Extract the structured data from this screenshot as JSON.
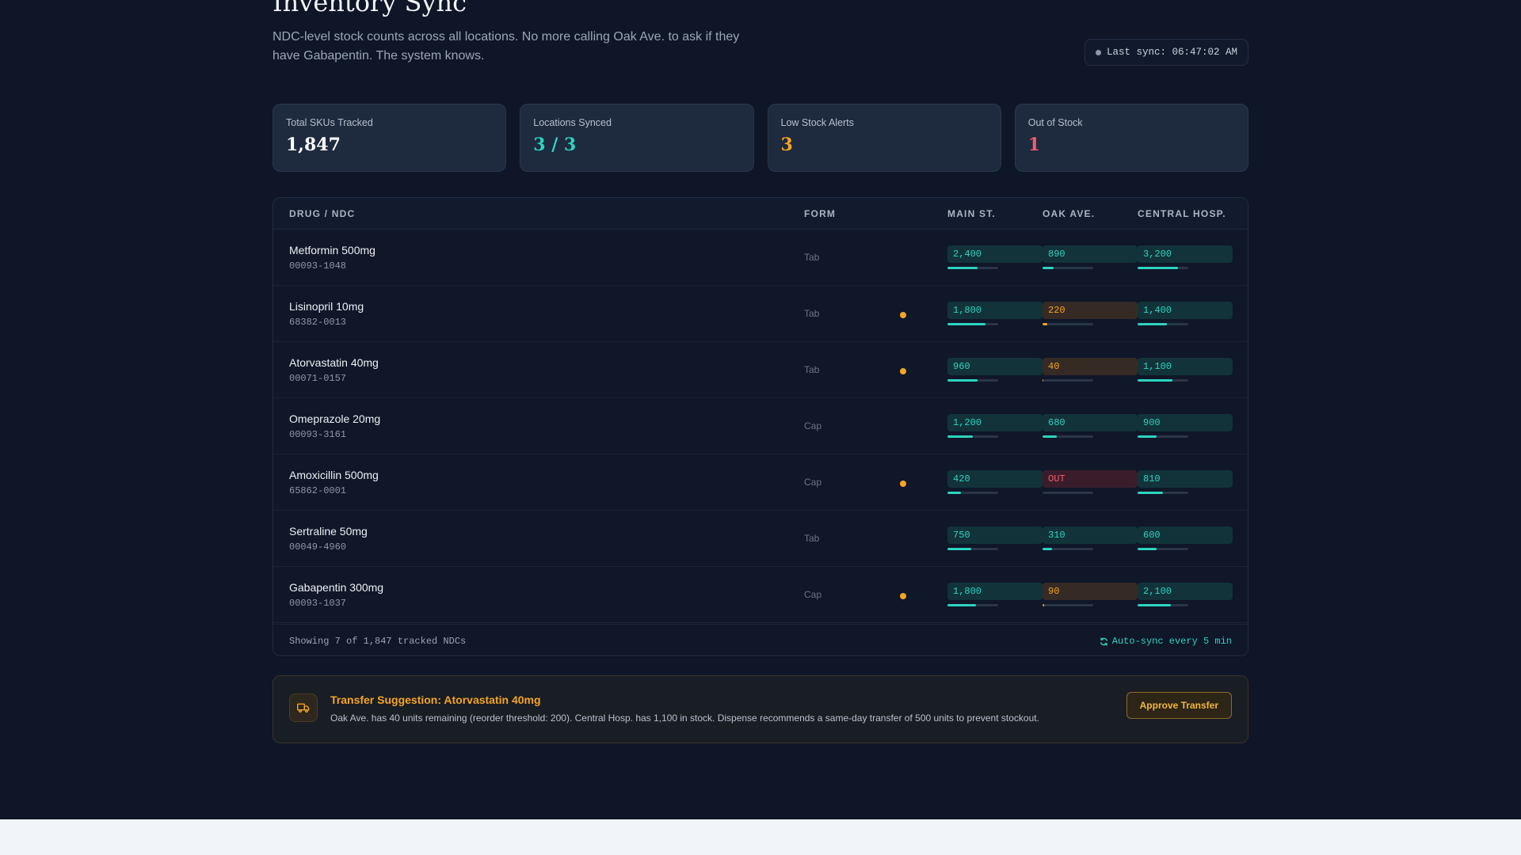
{
  "header": {
    "title": "Inventory Sync",
    "subtitle": "NDC-level stock counts across all locations. No more calling Oak Ave. to ask if they have Gabapentin. The system knows.",
    "last_sync": "Last sync: 06:47:02 AM"
  },
  "stats": [
    {
      "label": "Total SKUs Tracked",
      "value": "1,847",
      "color": "#ffffff"
    },
    {
      "label": "Locations Synced",
      "value": "3 / 3",
      "color": "#2dd4bf"
    },
    {
      "label": "Low Stock Alerts",
      "value": "3",
      "color": "#f5a524"
    },
    {
      "label": "Out of Stock",
      "value": "1",
      "color": "#f05d6c"
    }
  ],
  "table": {
    "columns": [
      "DRUG / NDC",
      "FORM",
      "MAIN ST.",
      "OAK AVE.",
      "CENTRAL HOSP."
    ],
    "rows": [
      {
        "drug": "Metformin 500mg",
        "ndc": "00093-1048",
        "form": "Tab",
        "alert": false,
        "stock": [
          {
            "text": "2,400",
            "status": "ok",
            "level": 0.6
          },
          {
            "text": "890",
            "status": "ok",
            "level": 0.22
          },
          {
            "text": "3,200",
            "status": "ok",
            "level": 0.8
          }
        ]
      },
      {
        "drug": "Lisinopril 10mg",
        "ndc": "68382-0013",
        "form": "Tab",
        "alert": true,
        "stock": [
          {
            "text": "1,800",
            "status": "ok",
            "level": 0.75
          },
          {
            "text": "220",
            "status": "low",
            "level": 0.09
          },
          {
            "text": "1,400",
            "status": "ok",
            "level": 0.58
          }
        ]
      },
      {
        "drug": "Atorvastatin 40mg",
        "ndc": "00071-0157",
        "form": "Tab",
        "alert": true,
        "stock": [
          {
            "text": "960",
            "status": "ok",
            "level": 0.6
          },
          {
            "text": "40",
            "status": "low",
            "level": 0.02
          },
          {
            "text": "1,100",
            "status": "ok",
            "level": 0.69
          }
        ]
      },
      {
        "drug": "Omeprazole 20mg",
        "ndc": "00093-3161",
        "form": "Cap",
        "alert": false,
        "stock": [
          {
            "text": "1,200",
            "status": "ok",
            "level": 0.5
          },
          {
            "text": "680",
            "status": "ok",
            "level": 0.28
          },
          {
            "text": "900",
            "status": "ok",
            "level": 0.37
          }
        ]
      },
      {
        "drug": "Amoxicillin 500mg",
        "ndc": "65862-0001",
        "form": "Cap",
        "alert": true,
        "stock": [
          {
            "text": "420",
            "status": "ok",
            "level": 0.26
          },
          {
            "text": "OUT",
            "status": "out",
            "level": 0
          },
          {
            "text": "810",
            "status": "ok",
            "level": 0.5
          }
        ]
      },
      {
        "drug": "Sertraline 50mg",
        "ndc": "00049-4960",
        "form": "Tab",
        "alert": false,
        "stock": [
          {
            "text": "750",
            "status": "ok",
            "level": 0.47
          },
          {
            "text": "310",
            "status": "ok",
            "level": 0.19
          },
          {
            "text": "600",
            "status": "ok",
            "level": 0.37
          }
        ]
      },
      {
        "drug": "Gabapentin 300mg",
        "ndc": "00093-1037",
        "form": "Cap",
        "alert": true,
        "stock": [
          {
            "text": "1,800",
            "status": "ok",
            "level": 0.56
          },
          {
            "text": "90",
            "status": "low",
            "level": 0.03
          },
          {
            "text": "2,100",
            "status": "ok",
            "level": 0.66
          }
        ]
      }
    ],
    "footer_left": "Showing 7 of 1,847 tracked NDCs",
    "footer_right": "Auto-sync every 5 min"
  },
  "transfer": {
    "title": "Transfer Suggestion: Atorvastatin 40mg",
    "body": "Oak Ave. has 40 units remaining (reorder threshold: 200). Central Hosp. has 1,100 in stock. Dispense recommends a same-day transfer of 500 units to prevent stockout.",
    "button": "Approve Transfer",
    "icon": "truck-icon"
  },
  "colors": {
    "background": "#0e1628",
    "ok": "#2dd4bf",
    "low": "#f5a524",
    "out": "#f05d6c"
  }
}
